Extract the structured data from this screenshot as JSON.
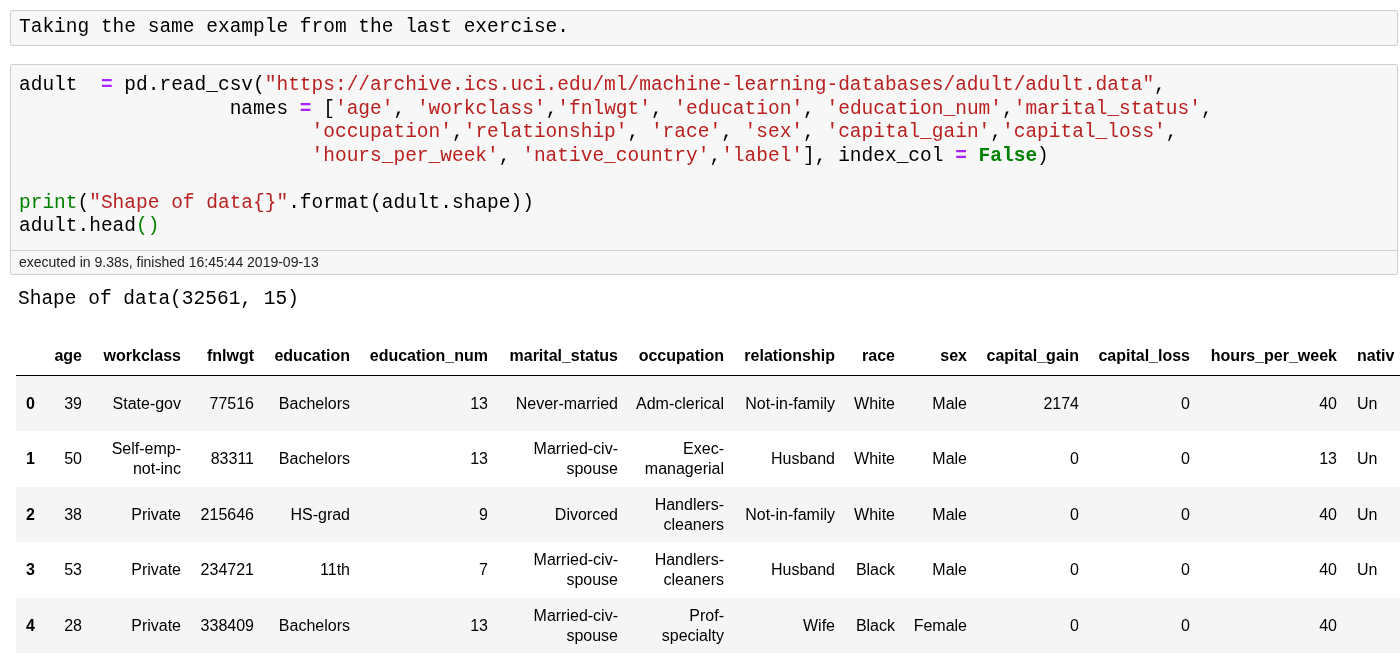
{
  "markdown_cell": {
    "text": "Taking the same example from the last exercise."
  },
  "code_cell": {
    "lines": [
      {
        "gap_before": false,
        "tokens": [
          {
            "text": "adult  ",
            "kind": "plain"
          },
          {
            "text": "=",
            "kind": "operator"
          },
          {
            "text": " pd.read_csv(",
            "kind": "plain"
          },
          {
            "text": "\"https://archive.ics.uci.edu/ml/machine-learning-databases/adult/adult.data\"",
            "kind": "string"
          },
          {
            "text": ",",
            "kind": "plain"
          }
        ]
      },
      {
        "gap_before": false,
        "tokens": [
          {
            "text": "                  names ",
            "kind": "plain"
          },
          {
            "text": "=",
            "kind": "operator"
          },
          {
            "text": " [",
            "kind": "plain"
          },
          {
            "text": "'age'",
            "kind": "string"
          },
          {
            "text": ", ",
            "kind": "plain"
          },
          {
            "text": "'workclass'",
            "kind": "string"
          },
          {
            "text": ",",
            "kind": "plain"
          },
          {
            "text": "'fnlwgt'",
            "kind": "string"
          },
          {
            "text": ", ",
            "kind": "plain"
          },
          {
            "text": "'education'",
            "kind": "string"
          },
          {
            "text": ", ",
            "kind": "plain"
          },
          {
            "text": "'education_num'",
            "kind": "string"
          },
          {
            "text": ",",
            "kind": "plain"
          },
          {
            "text": "'marital_status'",
            "kind": "string"
          },
          {
            "text": ",",
            "kind": "plain"
          }
        ]
      },
      {
        "gap_before": false,
        "tokens": [
          {
            "text": "                         'occupation'",
            "kind": "string"
          },
          {
            "text": ",",
            "kind": "plain"
          },
          {
            "text": "'relationship'",
            "kind": "string"
          },
          {
            "text": ", ",
            "kind": "plain"
          },
          {
            "text": "'race'",
            "kind": "string"
          },
          {
            "text": ", ",
            "kind": "plain"
          },
          {
            "text": "'sex'",
            "kind": "string"
          },
          {
            "text": ", ",
            "kind": "plain"
          },
          {
            "text": "'capital_gain'",
            "kind": "string"
          },
          {
            "text": ",",
            "kind": "plain"
          },
          {
            "text": "'capital_loss'",
            "kind": "string"
          },
          {
            "text": ",",
            "kind": "plain"
          }
        ]
      },
      {
        "gap_before": false,
        "tokens": [
          {
            "text": "                         'hours_per_week'",
            "kind": "string"
          },
          {
            "text": ", ",
            "kind": "plain"
          },
          {
            "text": "'native_country'",
            "kind": "string"
          },
          {
            "text": ",",
            "kind": "plain"
          },
          {
            "text": "'label'",
            "kind": "string"
          },
          {
            "text": "], index_col ",
            "kind": "plain"
          },
          {
            "text": "=",
            "kind": "operator"
          },
          {
            "text": " False",
            "kind": "keyword"
          },
          {
            "text": ")",
            "kind": "plain"
          }
        ]
      },
      {
        "gap_before": true,
        "tokens": [
          {
            "text": "print",
            "kind": "builtin"
          },
          {
            "text": "(",
            "kind": "plain"
          },
          {
            "text": "\"Shape of data{}\"",
            "kind": "string"
          },
          {
            "text": ".format(adult.shape))",
            "kind": "plain"
          }
        ]
      },
      {
        "gap_before": false,
        "tokens": [
          {
            "text": "adult.head",
            "kind": "plain"
          },
          {
            "text": "()",
            "kind": "builtin"
          }
        ]
      }
    ],
    "execution_info": "executed in 9.38s, finished 16:45:44 2019-09-13"
  },
  "output_text": "Shape of data(32561, 15)",
  "table": {
    "columns": [
      "age",
      "workclass",
      "fnlwgt",
      "education",
      "education_num",
      "marital_status",
      "occupation",
      "relationship",
      "race",
      "sex",
      "capital_gain",
      "capital_loss",
      "hours_per_week",
      "nativ"
    ],
    "rows": [
      {
        "index": "0",
        "cells": [
          "39",
          "State-gov",
          "77516",
          "Bachelors",
          "13",
          "Never-married",
          "Adm-clerical",
          "Not-in-family",
          "White",
          "Male",
          "2174",
          "0",
          "40",
          "Un"
        ]
      },
      {
        "index": "1",
        "cells": [
          "50",
          "Self-emp-not-inc",
          "83311",
          "Bachelors",
          "13",
          "Married-civ-spouse",
          "Exec-managerial",
          "Husband",
          "White",
          "Male",
          "0",
          "0",
          "13",
          "Un"
        ]
      },
      {
        "index": "2",
        "cells": [
          "38",
          "Private",
          "215646",
          "HS-grad",
          "9",
          "Divorced",
          "Handlers-cleaners",
          "Not-in-family",
          "White",
          "Male",
          "0",
          "0",
          "40",
          "Un"
        ]
      },
      {
        "index": "3",
        "cells": [
          "53",
          "Private",
          "234721",
          "11th",
          "7",
          "Married-civ-spouse",
          "Handlers-cleaners",
          "Husband",
          "Black",
          "Male",
          "0",
          "0",
          "40",
          "Un"
        ]
      },
      {
        "index": "4",
        "cells": [
          "28",
          "Private",
          "338409",
          "Bachelors",
          "13",
          "Married-civ-spouse",
          "Prof-specialty",
          "Wife",
          "Black",
          "Female",
          "0",
          "0",
          "40"
        ]
      }
    ]
  }
}
